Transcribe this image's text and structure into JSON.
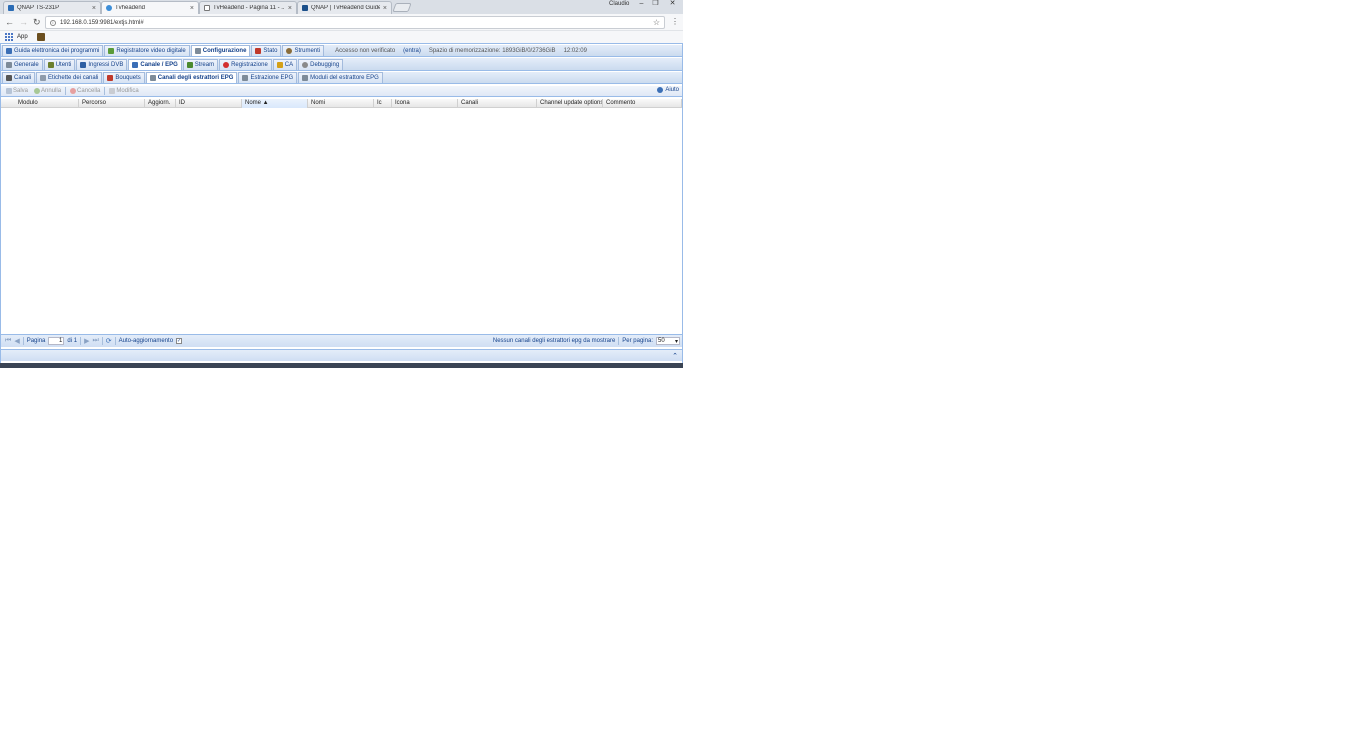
{
  "browser": {
    "tabs": [
      {
        "title": "QNAP TS-231P",
        "color": "#2b6cb5"
      },
      {
        "title": "Tvheadend",
        "color": "#3d8ed8"
      },
      {
        "title": "TvHeadend - Pagina 11 - ...",
        "color": "#666666"
      },
      {
        "title": "QNAP | TvHeadend Guide ...",
        "color": "#1b4f8a"
      }
    ],
    "user": "Claudio",
    "url": "192.168.0.159:9981/extjs.html#",
    "bookmarks_label": "App"
  },
  "tvh": {
    "main_tabs": [
      "Guida elettronica dei programmi",
      "Registratore video digitale",
      "Configurazione",
      "Stato",
      "Strumenti"
    ],
    "status": {
      "access": "Accesso non verificato",
      "login": "(entra)",
      "storage": "Spazio di memorizzazione: 1893GiB/0/2736GiB",
      "time": "12:02:09"
    },
    "config_tabs": [
      "Generale",
      "Utenti",
      "Ingressi DVB",
      "Canale / EPG",
      "Stream",
      "Registrazione",
      "CA",
      "Debugging"
    ],
    "sub_tabs": [
      "Canali",
      "Etichette dei canali",
      "Bouquets",
      "Canali degli estrattori EPG",
      "Estrazione EPG",
      "Moduli del estrattore EPG"
    ],
    "toolbar": {
      "save": "Salva",
      "undo": "Annulla",
      "delete": "Cancella",
      "edit": "Modifica",
      "help": "Aiuto"
    },
    "columns": [
      {
        "label": "Modulo",
        "w": 78,
        "sorted": false
      },
      {
        "label": "Percorso",
        "w": 66,
        "sorted": false
      },
      {
        "label": "Aggiorn.",
        "w": 31,
        "sorted": false
      },
      {
        "label": "ID",
        "w": 66,
        "sorted": false
      },
      {
        "label": "Nome ▲",
        "w": 66,
        "sorted": true
      },
      {
        "label": "Nomi",
        "w": 66,
        "sorted": false
      },
      {
        "label": "Ic",
        "w": 18,
        "sorted": false
      },
      {
        "label": "Icona",
        "w": 66,
        "sorted": false
      },
      {
        "label": "Canali",
        "w": 79,
        "sorted": false
      },
      {
        "label": "Channel update options",
        "w": 66,
        "sorted": false
      },
      {
        "label": "Commento",
        "w": 79,
        "sorted": false
      }
    ],
    "paging": {
      "page_label": "Pagina",
      "page_value": "1",
      "of_label": "di 1",
      "auto_refresh": "Auto-aggiornamento",
      "empty_msg": "Nessun canali degli estrattori epg da mostrare",
      "per_page_label": "Per pagina:",
      "per_page": "50"
    }
  }
}
